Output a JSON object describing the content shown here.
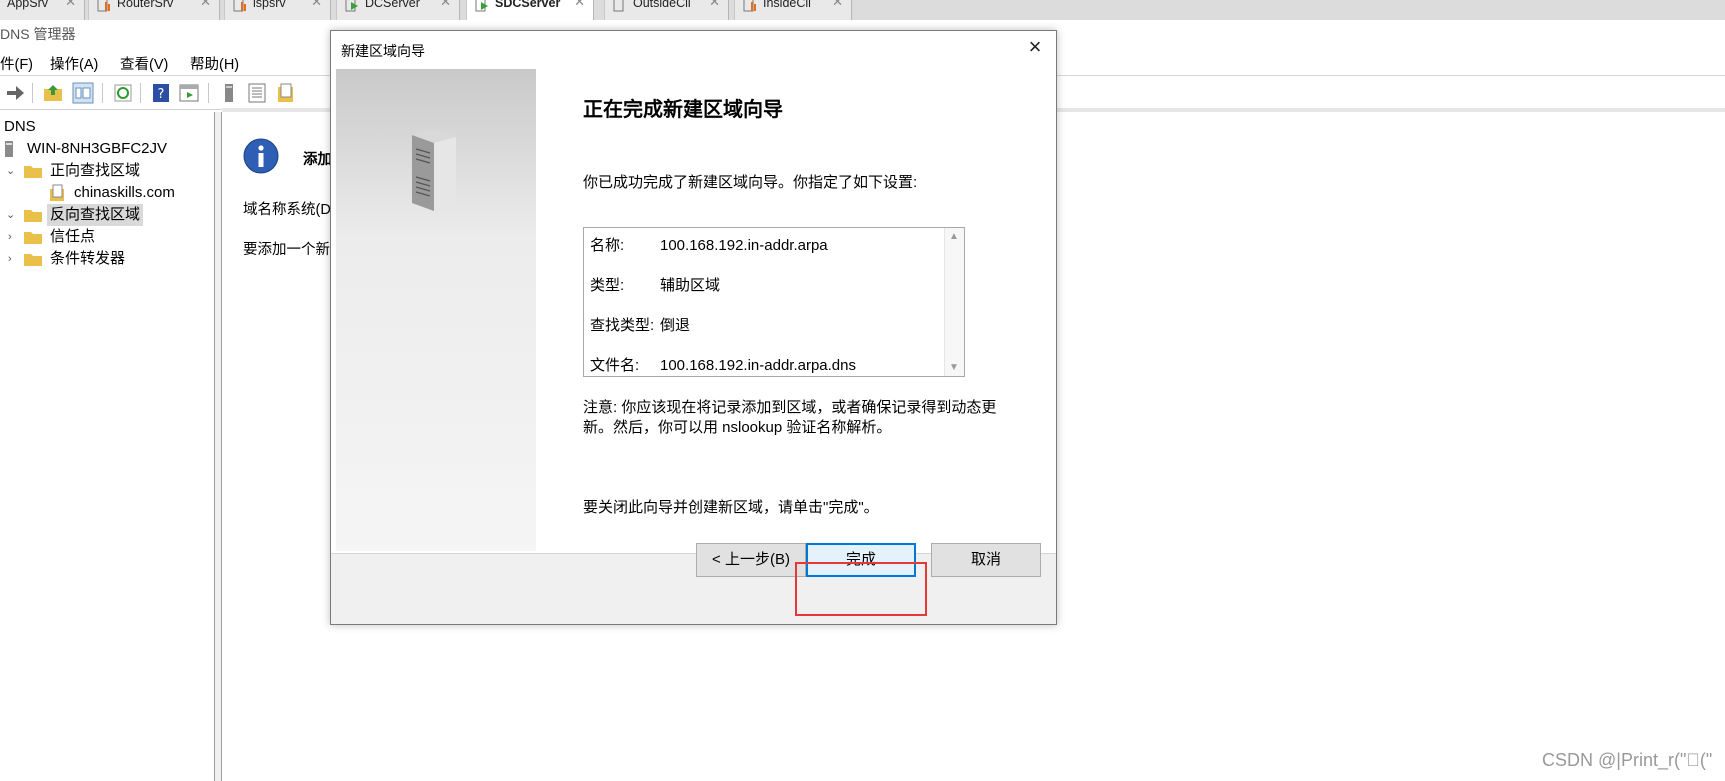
{
  "tabs": [
    {
      "label": "AppSrv",
      "active": false
    },
    {
      "label": "RouterSrv",
      "active": false
    },
    {
      "label": "ispsrv",
      "active": false
    },
    {
      "label": "DCServer",
      "active": false
    },
    {
      "label": "SDCServer",
      "active": true
    },
    {
      "label": "OutsideCli",
      "active": false
    },
    {
      "label": "InsideCli",
      "active": false
    }
  ],
  "app": {
    "title": "DNS 管理器"
  },
  "menu": {
    "file": "件(F)",
    "action": "操作(A)",
    "view": "查看(V)",
    "help": "帮助(H)"
  },
  "tree": {
    "root": "DNS",
    "server": "WIN-8NH3GBFC2JV",
    "forward_zones": "正向查找区域",
    "zone_chinaskills": "chinaskills.com",
    "reverse_zones": "反向查找区域",
    "trust_points": "信任点",
    "conditional_forwarders": "条件转发器"
  },
  "content": {
    "heading_partial": "添加",
    "line1_partial": "域名称系统(D",
    "line2_partial": "要添加一个新"
  },
  "dialog": {
    "title": "新建区域向导",
    "heading": "正在完成新建区域向导",
    "intro": "你已成功完成了新建区域向导。你指定了如下设置:",
    "summary": [
      {
        "key": "名称:",
        "value": "100.168.192.in-addr.arpa"
      },
      {
        "key": "类型:",
        "value": "辅助区域"
      },
      {
        "key": "查找类型:",
        "value": "倒退"
      },
      {
        "key": "文件名:",
        "value": "100.168.192.in-addr.arpa.dns"
      }
    ],
    "note_line1": "注意: 你应该现在将记录添加到区域，或者确保记录得到动态更",
    "note_line2": "新。然后，你可以用 nslookup 验证名称解析。",
    "close_hint": "要关闭此向导并创建新区域，请单击\"完成\"。",
    "back_button": "< 上一步(B)",
    "finish_button": "完成",
    "cancel_button": "取消"
  },
  "watermark": "CSDN @|Print_r(\"\u0000(\""
}
